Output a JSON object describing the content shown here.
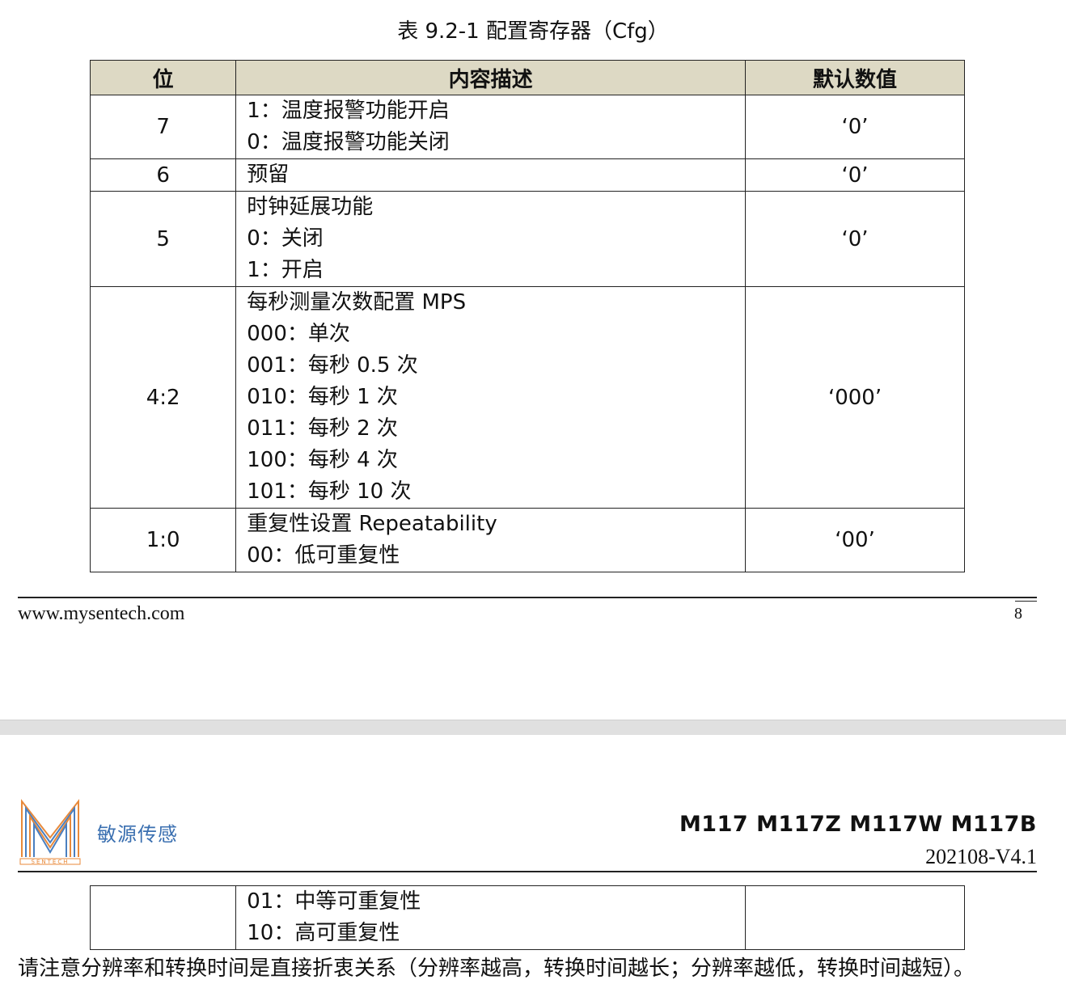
{
  "table_caption": "表 9.2-1 配置寄存器（Cfg）",
  "table": {
    "headers": [
      "位",
      "内容描述",
      "默认数值"
    ],
    "rows": [
      {
        "bit": "7",
        "desc": [
          "1：温度报警功能开启",
          "0：温度报警功能关闭"
        ],
        "default": "‘0’"
      },
      {
        "bit": "6",
        "desc": [
          "预留"
        ],
        "default": "‘0’"
      },
      {
        "bit": "5",
        "desc": [
          "时钟延展功能",
          "0：关闭",
          "1：开启"
        ],
        "default": "‘0’"
      },
      {
        "bit": "4:2",
        "desc": [
          "每秒测量次数配置 MPS",
          "000：单次",
          "001：每秒 0.5 次",
          "010：每秒 1 次",
          "011：每秒 2 次",
          "100：每秒 4 次",
          "101：每秒 10 次"
        ],
        "default": "‘000’"
      },
      {
        "bit": "1:0",
        "desc": [
          "重复性设置 Repeatability",
          "00：低可重复性"
        ],
        "default": "‘00’"
      }
    ],
    "continued_rows": [
      {
        "bit": "",
        "desc": [
          "01：中等可重复性",
          "10：高可重复性"
        ],
        "default": ""
      }
    ]
  },
  "footer": {
    "url": "www.mysentech.com",
    "page_number": "8"
  },
  "header": {
    "brand": "敏源传感",
    "logo_text": "SENTECH",
    "models": "M117  M117Z  M117W  M117B",
    "version": "202108-V4.1"
  },
  "note": "请注意分辨率和转换时间是直接折衷关系（分辨率越高，转换时间越长；分辨率越低，转换时间越短）。",
  "colors": {
    "table_header_bg": "#ddd9c4",
    "brand": "#3a6fb0",
    "logo_orange": "#e8893a",
    "logo_blue": "#4a7fc0"
  }
}
